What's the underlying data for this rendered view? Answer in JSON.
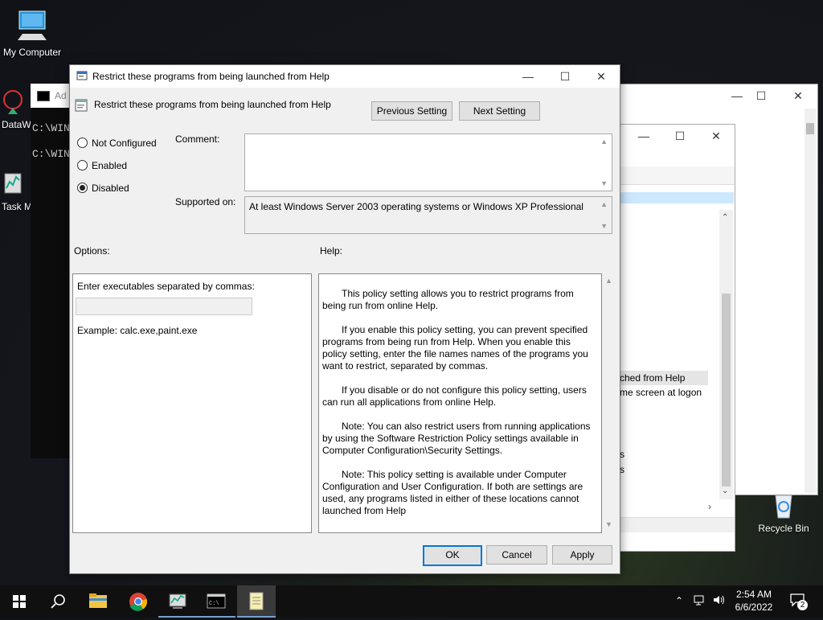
{
  "desktop": {
    "icons": [
      {
        "label": "My Computer"
      },
      {
        "label": "DataW"
      },
      {
        "label": "Task M"
      },
      {
        "label": "Recycle Bin"
      }
    ]
  },
  "background_windows": {
    "cmd_title": "Ad",
    "cmd_lines": [
      "C:\\WIN",
      "C:\\WIN"
    ],
    "explorer_lines": [
      "ched from Help",
      "me screen at logon",
      "s",
      "s"
    ]
  },
  "dialog": {
    "window_title": "Restrict these programs from being launched from Help",
    "header_title": "Restrict these programs from being launched from Help",
    "previous_setting": "Previous Setting",
    "next_setting": "Next Setting",
    "radios": [
      {
        "label": "Not Configured",
        "checked": false
      },
      {
        "label": "Enabled",
        "checked": false
      },
      {
        "label": "Disabled",
        "checked": true
      }
    ],
    "comment_label": "Comment:",
    "comment_value": "",
    "supported_label": "Supported on:",
    "supported_value": "At least Windows Server 2003 operating systems or Windows XP Professional",
    "options_label": "Options:",
    "help_label": "Help:",
    "options": {
      "field_label": "Enter executables separated by commas:",
      "field_value": "",
      "example": "Example: calc.exe,paint.exe"
    },
    "help_paragraphs": [
      "This policy setting allows you to restrict programs from being run from online Help.",
      "If you enable this policy setting, you can prevent specified programs from being run from Help. When you enable this policy setting, enter the file names names of the programs you want to restrict, separated by commas.",
      "If you disable or do not configure this policy setting, users can run all applications from online Help.",
      "Note: You can also restrict users from running applications by using the Software Restriction Policy settings available in Computer Configuration\\Security Settings.",
      "Note: This policy setting is available under Computer Configuration and User Configuration. If both are settings are used, any programs listed in either of these locations cannot launched from Help"
    ],
    "ok": "OK",
    "cancel": "Cancel",
    "apply": "Apply"
  },
  "taskbar": {
    "time": "2:54 AM",
    "date": "6/6/2022",
    "notification_count": "2"
  },
  "colors": {
    "accent": "#0078d7",
    "taskbar": "#101010",
    "dialog_bg": "#f0f0f0"
  }
}
